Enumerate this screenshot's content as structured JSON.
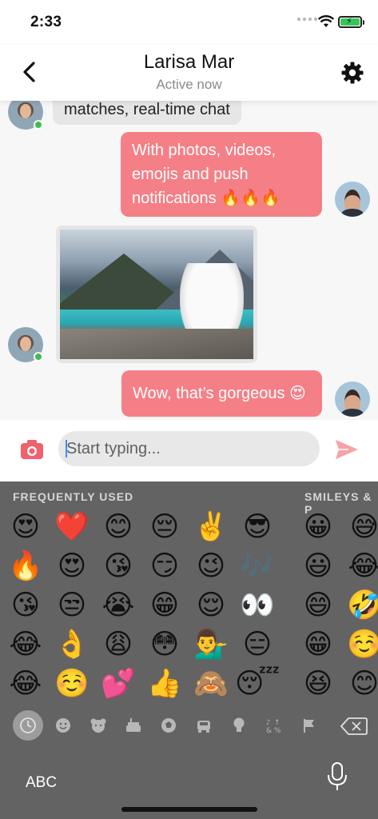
{
  "status": {
    "time": "2:33"
  },
  "header": {
    "title": "Larisa Mar",
    "subtitle": "Active now"
  },
  "messages": [
    {
      "direction": "in",
      "type": "text",
      "text": "matches, real-time chat"
    },
    {
      "direction": "out",
      "type": "text",
      "lines": [
        "With photos, videos,",
        "emojis and push",
        "notifications 🔥🔥🔥"
      ]
    },
    {
      "direction": "in",
      "type": "image",
      "image_desc": "dog by lake"
    },
    {
      "direction": "out",
      "type": "text",
      "text": "Wow, that’s gorgeous 😍"
    }
  ],
  "composer": {
    "placeholder": "Start typing..."
  },
  "keyboard": {
    "section_frequent": "FREQUENTLY USED",
    "section_smileys": "SMILEYS & P",
    "frequent_rows": [
      [
        "😍",
        "❤️",
        "😊",
        "😔",
        "✌️",
        "😎"
      ],
      [
        "🔥",
        "😍",
        "😘",
        "😏",
        "😉",
        "🎶"
      ],
      [
        "😘",
        "😒",
        "😭",
        "😁",
        "😌",
        "👀"
      ],
      [
        "😂",
        "👌",
        "😩",
        "😳",
        "💁‍♂️",
        "😑"
      ],
      [
        "😂",
        "☺️",
        "💕",
        "👍",
        "🙈",
        "😴"
      ]
    ],
    "smileys_col1": [
      "😀",
      "😃",
      "😄",
      "😁",
      "😆"
    ],
    "smileys_col2": [
      "😅",
      "😂",
      "🤣",
      "☺️",
      "😊"
    ],
    "abc_label": "ABC"
  },
  "colors": {
    "accent": "#f57f87",
    "online": "#3bc14a",
    "keyboard_bg": "#636363"
  }
}
